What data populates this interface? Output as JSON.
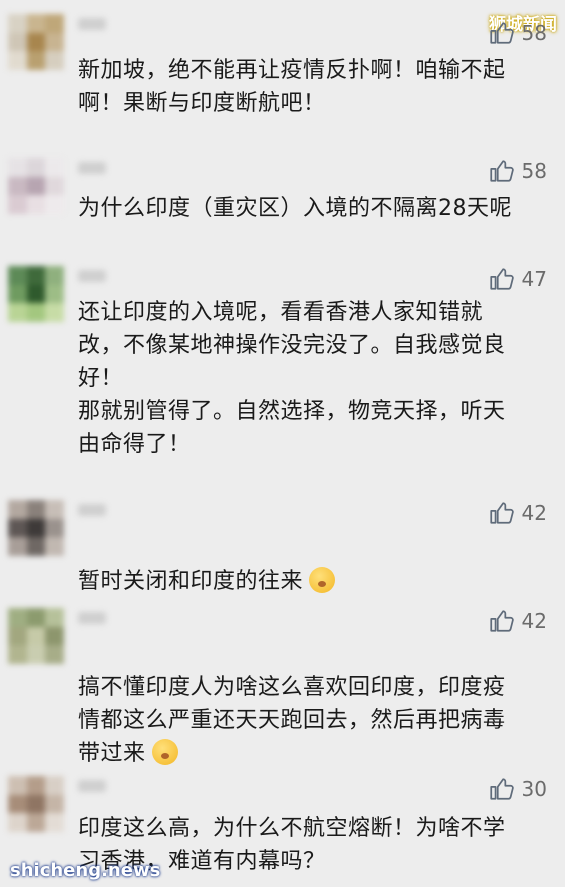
{
  "watermark": {
    "top": "狮城新闻",
    "bottom": "shicheng.news"
  },
  "comments": [
    {
      "likes": "58",
      "text": "新加坡，绝不能再让疫情反扑啊！咱输不起\n啊！果断与印度断航吧！",
      "avatar_colors": [
        "#d8d2c4",
        "#c9b58f",
        "#bfa779",
        "#cfc6b6",
        "#a8864e",
        "#c8b491",
        "#e1dbcf",
        "#b9a070",
        "#d6cebf"
      ]
    },
    {
      "likes": "58",
      "text": "为什么印度（重灾区）入境的不隔离28天呢",
      "avatar_colors": [
        "#e6e2e5",
        "#dcd6da",
        "#ece9eb",
        "#c9b9c2",
        "#b7a5b1",
        "#e0d8dc",
        "#dacbd2",
        "#e8dfe3",
        "#eeeaec"
      ]
    },
    {
      "likes": "47",
      "text": "还让印度的入境呢，看看香港人家知错就\n改，不像某地神操作没完没了。自我感觉良\n好！\n那就别管得了。自然选择，物竞天择，听天\n由命得了！",
      "avatar_colors": [
        "#5d8a57",
        "#3f6a3b",
        "#8fb07e",
        "#6f9b60",
        "#2f5a2d",
        "#9dbd86",
        "#b9d495",
        "#a3c77f",
        "#c7dca6"
      ]
    },
    {
      "likes": "42",
      "text": "暂时关闭和印度的往来",
      "avatar_colors": [
        "#b3a8a0",
        "#8a817b",
        "#c7beb7",
        "#5e5755",
        "#3e3a39",
        "#9a928d",
        "#a89e98",
        "#6f6864",
        "#c1b8b1"
      ]
    },
    {
      "likes": "42",
      "text": "搞不懂印度人为啥这么喜欢回印度，印度疫\n情都这么严重还天天跑回去，然后再把病毒\n带过来",
      "avatar_colors": [
        "#9fae82",
        "#8c9b6e",
        "#b6c19a",
        "#a2a77f",
        "#c6caa8",
        "#8d966d",
        "#b1b58f",
        "#c9cdb0",
        "#a7ad88"
      ]
    },
    {
      "likes": "30",
      "text": "印度这么高，为什么不航空熔断！为啥不学\n习香港，难道有内幕吗？",
      "avatar_colors": [
        "#cdbfb2",
        "#b49d8a",
        "#d8cfc6",
        "#a78d79",
        "#8f7563",
        "#c5b5a7",
        "#ddd4cb",
        "#bca897",
        "#e3dcd5"
      ]
    }
  ]
}
